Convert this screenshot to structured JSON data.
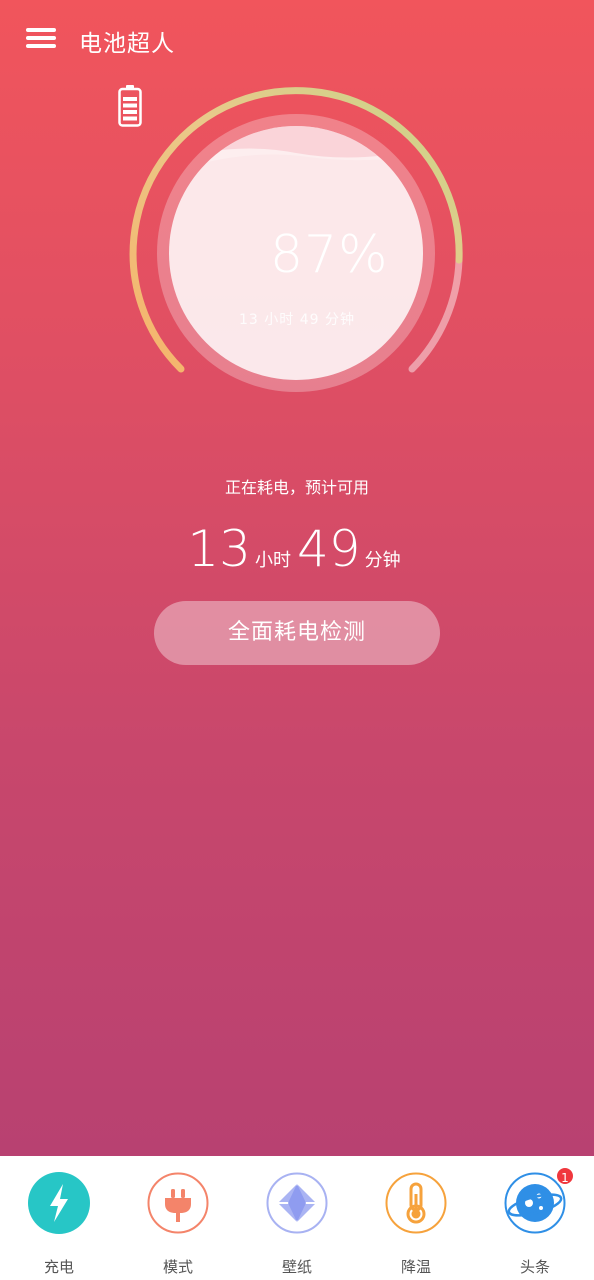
{
  "app": {
    "title": "电池超人"
  },
  "battery": {
    "percent_text": "87%",
    "percent_value": 87,
    "remaining_small": "13 小时 49 分钟"
  },
  "status": {
    "text": "正在耗电，预计可用",
    "hours": "13",
    "hours_unit": "小时",
    "minutes": "49",
    "minutes_unit": "分钟"
  },
  "actions": {
    "detect_label": "全面耗电检测"
  },
  "nav": {
    "items": [
      {
        "label": "充电",
        "icon": "lightning-icon",
        "color": "#27c6c6"
      },
      {
        "label": "模式",
        "icon": "plug-icon",
        "color": "#f4846a"
      },
      {
        "label": "壁纸",
        "icon": "diamond-icon",
        "color": "#8f9cf0"
      },
      {
        "label": "降温",
        "icon": "thermometer-icon",
        "color": "#f6a23c"
      },
      {
        "label": "头条",
        "icon": "planet-icon",
        "color": "#2f8fe6",
        "badge": "1"
      }
    ]
  },
  "colors": {
    "gradient_top": "#f1555c",
    "gradient_bottom": "#b84171",
    "arc_start": "#f6b36a",
    "arc_end": "#c9d48a"
  }
}
